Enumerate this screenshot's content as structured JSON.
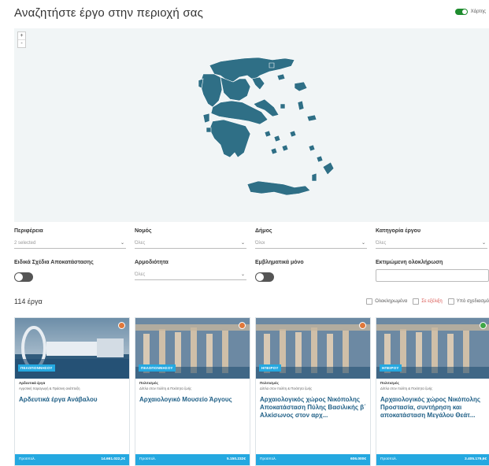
{
  "header": {
    "title": "Αναζητήστε έργο στην περιοχή σας",
    "map_toggle_label": "Χάρτης"
  },
  "map": {
    "zoom_in": "+",
    "zoom_out": "-",
    "land_color": "#2f6f86"
  },
  "filters": {
    "region": {
      "label": "Περιφέρεια",
      "value": "2 selected"
    },
    "nomos": {
      "label": "Νομός",
      "value": "Όλες"
    },
    "dimos": {
      "label": "Δήμος",
      "value": "Όλοι"
    },
    "category": {
      "label": "Κατηγορία έργου",
      "value": "Όλες"
    },
    "special_plans": {
      "label": "Ειδικά Σχέδια Αποκατάστασης"
    },
    "responsibility": {
      "label": "Αρμοδιότητα",
      "value": "Όλες"
    },
    "flagship": {
      "label": "Εμβληματικά μόνο"
    },
    "completion": {
      "label": "Εκτιμώμενη ολοκλήρωση",
      "value": ""
    }
  },
  "results": {
    "count_label": "114 έργα",
    "status_filters": [
      {
        "label": "Ολοκληρωμένα",
        "color": "#555555"
      },
      {
        "label": "Σε εξέλιξη",
        "color": "#d9534f"
      },
      {
        "label": "Υπό σχεδιασμό",
        "color": "#555555"
      }
    ]
  },
  "cards": [
    {
      "region": "ΠΕΛΟΠΟΝΝΗΣΟΥ",
      "category": "Αρδευτικά έργα",
      "subcategory": "Αγροτική παραγωγή & Πράσινη ανάπτυξη",
      "title": "Αρδευτικά έργα Ανάβαλου",
      "budget_label": "Προϋπολ.",
      "budget": "14.661.022,2€",
      "status_color": "#e0783a",
      "image": "wind"
    },
    {
      "region": "ΠΕΛΟΠΟΝΝΗΣΟΥ",
      "category": "Πολιτισμός",
      "subcategory": "Δίπλα στον πολίτη & Ποιότητα ζωής",
      "title": "Αρχαιολογικό Μουσείο Άργους",
      "budget_label": "Προϋπολ.",
      "budget": "5.150.232€",
      "status_color": "#e0783a",
      "image": "ruins"
    },
    {
      "region": "ΗΠΕΙΡΟΥ",
      "category": "Πολιτισμός",
      "subcategory": "Δίπλα στον πολίτη & Ποιότητα ζωής",
      "title": "Αρχαιολογικός χώρος Νικόπολης Αποκατάσταση Πύλης Βασιλικής β΄ Αλκίσωνος στον αρχ...",
      "budget_label": "Προϋπολ.",
      "budget": "606.000€",
      "status_color": "#e0783a",
      "image": "ruins"
    },
    {
      "region": "ΗΠΕΙΡΟΥ",
      "category": "Πολιτισμός",
      "subcategory": "Δίπλα στον πολίτη & Ποιότητα ζωής",
      "title": "Αρχαιολογικός χώρος Νικόπολης Προστασία, συντήρηση και αποκατάσταση Μεγάλου Θεάτ...",
      "budget_label": "Προϋπολ.",
      "budget": "3.405.179,6€",
      "status_color": "#3fa646",
      "image": "ruins"
    }
  ]
}
